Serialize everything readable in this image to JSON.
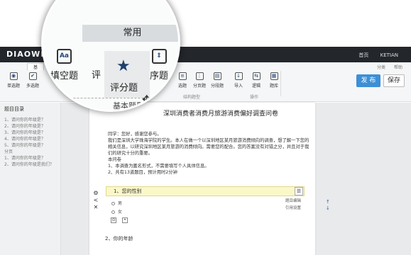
{
  "brand": "DIAOWEN",
  "top_nav": {
    "home": "首页",
    "user": "KETIAN"
  },
  "ribbon": {
    "active_tab": "基",
    "right_links": [
      "分类",
      "帮助"
    ],
    "buttons": [
      {
        "label": "单选题",
        "icon": "radio-icon"
      },
      {
        "label": "多选题",
        "icon": "checkbox-icon"
      },
      {
        "label": "选题",
        "icon": "choice-icon"
      },
      {
        "label": "分页题",
        "icon": "page-icon"
      },
      {
        "label": "分段题",
        "icon": "section-icon"
      },
      {
        "label": "导入",
        "icon": "import-icon"
      },
      {
        "label": "逻辑",
        "icon": "logic-icon"
      },
      {
        "label": "题库",
        "icon": "bank-icon"
      }
    ],
    "groups": [
      "结构题型",
      "操作"
    ],
    "publish": "发 布",
    "save": "保存"
  },
  "outline": {
    "title": "题目目录",
    "items": [
      "1、请问你的年级是？",
      "2、请问你的年级是？",
      "3、请问你的年级是？",
      "4、请问你的年级是？",
      "5、请问你的年级是？",
      "分页",
      "1、请问你的年级是？",
      "2、请问你的年级是我们？"
    ]
  },
  "survey": {
    "title": "深圳消费者消费月旅游消费偏好调查问卷",
    "intro": [
      "同学：您好，感谢您参与。",
      "我们是深圳大学珠海学院的学生。本人在做一个以深圳地区某月旅游消费倾向的调查，想了解一下您的相关信息，以研究深圳地区某月旅游的消费倾向。需要您的配合。您的答案没有对错之分，并且对于我们的研究十分的重要。",
      "本问卷",
      "1、本调查为匿名形式，不需要填写个人具体信息。",
      "2、共有13道题目，预计用时2分钟"
    ],
    "q1_num": "1、",
    "q1_text": "您的性别",
    "q1_options": [
      "男",
      "女"
    ],
    "q1_popup": [
      "题目编辑",
      "引用设置"
    ],
    "q2": "2、你的年龄"
  },
  "magnifier": {
    "tab": "常用",
    "buttons": [
      {
        "label": "填空题",
        "icon": "Aa"
      },
      {
        "label": "评",
        "icon": ""
      },
      {
        "label": "序题",
        "icon": "sort-icon"
      }
    ],
    "selected": "评分题",
    "group": "基本题型"
  }
}
